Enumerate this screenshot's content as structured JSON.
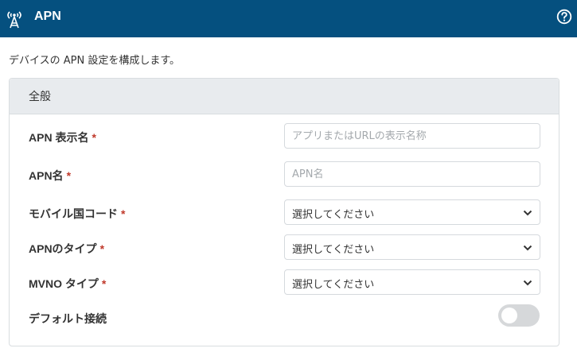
{
  "header": {
    "title": "APN",
    "icon": "antenna-icon",
    "help_icon": "help-icon",
    "background": "#05507f"
  },
  "description": "デバイスの APN 設定を構成します。",
  "section": {
    "title": "全般"
  },
  "fields": {
    "apn_display_name": {
      "label": "APN 表示名",
      "required_mark": "*",
      "value": "",
      "placeholder": "アプリまたはURLの表示名称"
    },
    "apn_name": {
      "label": "APN名",
      "required_mark": "*",
      "value": "",
      "placeholder": "APN名"
    },
    "mobile_country_code": {
      "label": "モバイル国コード",
      "required_mark": "*",
      "selected": "選択してください"
    },
    "apn_type": {
      "label": "APNのタイプ",
      "required_mark": "*",
      "selected": "選択してください"
    },
    "mvno_type": {
      "label": "MVNO タイプ",
      "required_mark": "*",
      "selected": "選択してください"
    },
    "default_connection": {
      "label": "デフォルト接続",
      "enabled": false
    }
  },
  "colors": {
    "required": "#c0392b",
    "toggle_off": "#d6d8da"
  }
}
